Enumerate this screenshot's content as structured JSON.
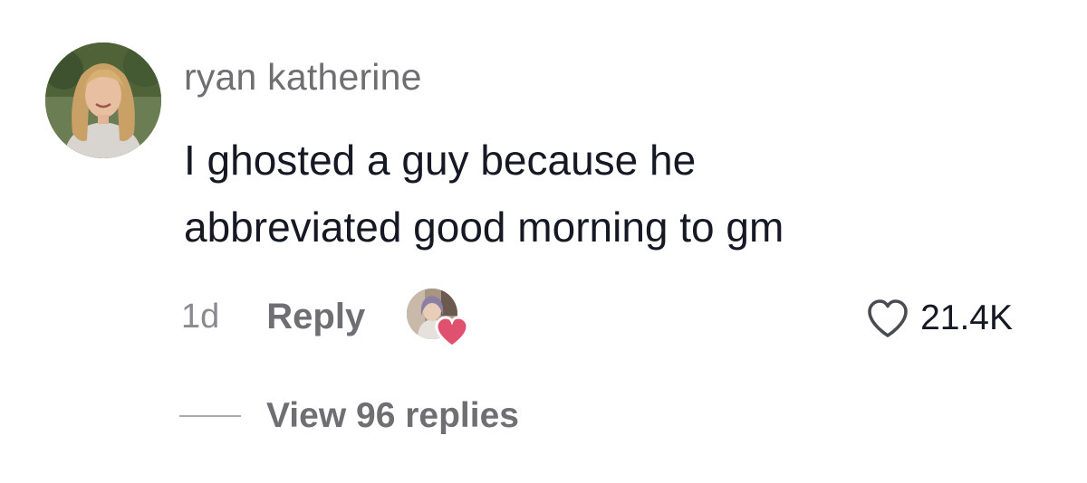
{
  "comment": {
    "avatar_icon": "user-avatar-photo",
    "username": "ryan katherine",
    "text_lines": [
      "I ghosted a guy because he",
      "abbreviated good morning to gm"
    ],
    "time": "1d",
    "reply_label": "Reply",
    "creator_liked_icon": "creator-avatar-with-heart",
    "like_icon": "heart-outline-icon",
    "like_count": "21.4K",
    "view_replies_label": "View 96 replies"
  },
  "colors": {
    "text_primary": "#161823",
    "text_secondary": "#6f6f73",
    "creator_heart": "#e0506f"
  }
}
